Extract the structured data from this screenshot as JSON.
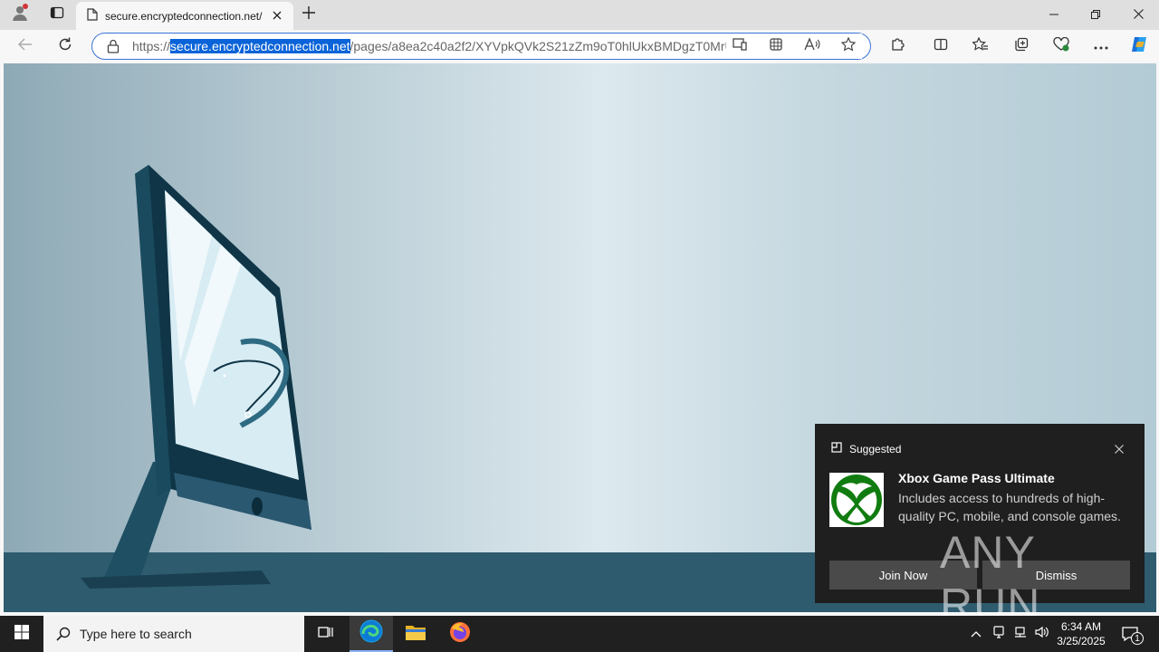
{
  "browser": {
    "tab_title": "secure.encryptedconnection.net/",
    "url_scheme": "https://",
    "url_domain": "secure.encryptedconnection.net",
    "url_path": "/pages/a8ea2c40a2f2/XYVpkQVk2S21zZm9oT0hlUkxBMDgzT0MrU"
  },
  "icons": {
    "profile": "profile-icon",
    "tab_actions": "tab-actions-icon",
    "page": "page-icon",
    "close_tab": "close-icon",
    "new_tab": "plus-icon",
    "minimize": "minimize-icon",
    "restore": "restore-icon",
    "close_window": "close-icon",
    "back": "back-arrow-icon",
    "refresh": "refresh-icon",
    "lock": "lock-icon",
    "extensions": "puzzle-icon",
    "split": "split-screen-icon",
    "favorites": "favorites-icon",
    "collections": "collections-icon",
    "performance": "heart-pulse-icon",
    "more": "ellipsis-icon",
    "copilot": "copilot-icon"
  },
  "toast": {
    "header": "Suggested",
    "title": "Xbox Game Pass Ultimate",
    "description": "Includes access to hundreds of high-quality PC, mobile, and console games.",
    "primary_button": "Join Now",
    "secondary_button": "Dismiss",
    "brand_color": "#107c10"
  },
  "taskbar": {
    "search_placeholder": "Type here to search",
    "time": "6:34 AM",
    "date": "3/25/2025",
    "notification_count": "1"
  },
  "watermark": "ANY RUN"
}
